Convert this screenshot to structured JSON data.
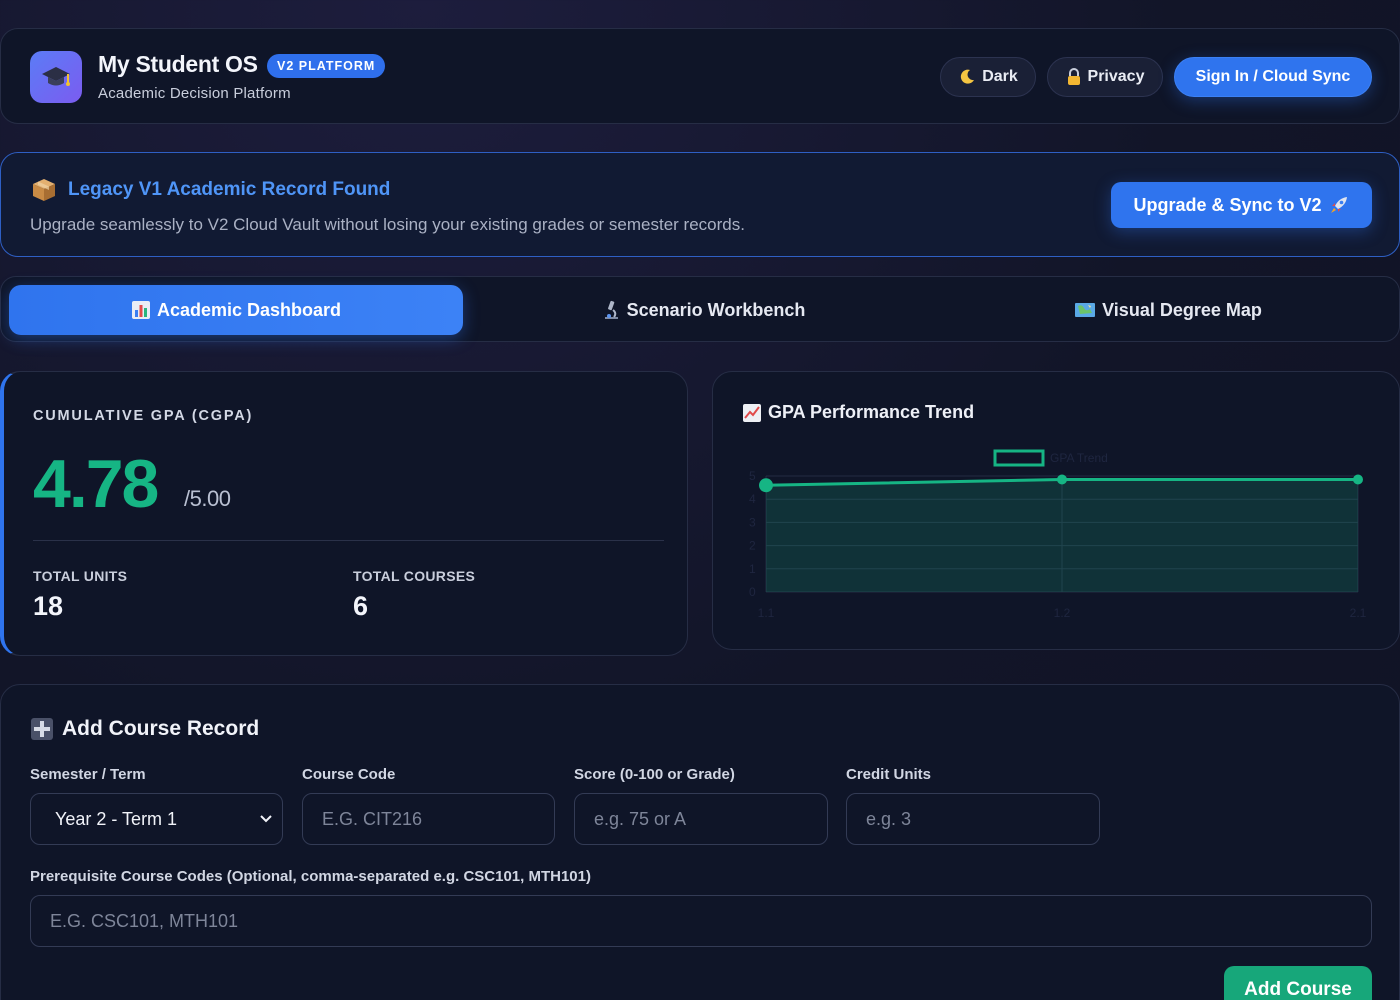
{
  "header": {
    "title": "My Student OS",
    "badge": "V2 PLATFORM",
    "subtitle": "Academic Decision Platform",
    "logo_icon": "graduation-cap-icon",
    "buttons": {
      "dark": "Dark",
      "privacy": "Privacy",
      "signin": "Sign In / Cloud Sync"
    }
  },
  "banner": {
    "icon": "package-icon",
    "title": "Legacy V1 Academic Record Found",
    "text": "Upgrade seamlessly to V2 Cloud Vault without losing your existing grades or semester records.",
    "button": "Upgrade & Sync to V2"
  },
  "tabs": [
    {
      "label": "Academic Dashboard",
      "icon": "bar-chart-icon",
      "active": true
    },
    {
      "label": "Scenario Workbench",
      "icon": "microscope-icon",
      "active": false
    },
    {
      "label": "Visual Degree Map",
      "icon": "map-icon",
      "active": false
    }
  ],
  "gpa": {
    "label": "CUMULATIVE GPA (CGPA)",
    "value": "4.78",
    "max": "/5.00",
    "units_label": "TOTAL UNITS",
    "units_value": "18",
    "courses_label": "TOTAL COURSES",
    "courses_value": "6"
  },
  "chart_title": "GPA Performance Trend",
  "chart_data": {
    "type": "line",
    "title": "GPA Performance Trend",
    "categories": [
      "1.1",
      "1.2",
      "2.1"
    ],
    "series": [
      {
        "name": "GPA Trend",
        "values": [
          4.6,
          4.85,
          4.85
        ]
      }
    ],
    "ylim": [
      0,
      5
    ],
    "yticks": [
      "0",
      "1",
      "2",
      "3",
      "4",
      "5"
    ],
    "fill": true,
    "grid": true,
    "legend": "top-center",
    "color": "#16b584"
  },
  "form": {
    "title": "Add Course Record",
    "title_icon": "plus-icon",
    "semester_label": "Semester / Term",
    "semester_value": "Year 2 - Term 1",
    "code_label": "Course Code",
    "code_placeholder": "E.G. CIT216",
    "score_label": "Score (0-100 or Grade)",
    "score_placeholder": "e.g. 75 or A",
    "units_label": "Credit Units",
    "units_placeholder": "e.g. 3",
    "prereq_label": "Prerequisite Course Codes (Optional, comma-separated e.g. CSC101, MTH101)",
    "prereq_placeholder": "E.G. CSC101, MTH101",
    "submit": "Add Course"
  },
  "colors": {
    "accent": "#2f74ee",
    "success": "#16b584",
    "background": "#121528",
    "card": "#0f1528"
  }
}
